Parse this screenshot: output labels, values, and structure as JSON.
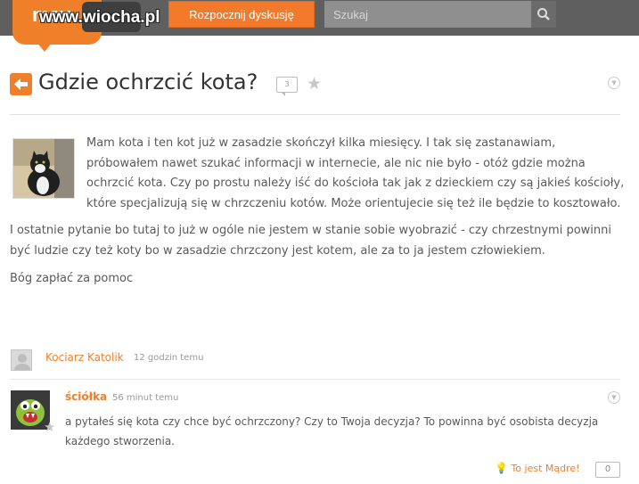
{
  "header": {
    "logo_text": "mov",
    "watermark": "www.wiocha.pl",
    "start_button_label": "Rozpocznij dyskusję",
    "search_placeholder": "Szukaj"
  },
  "question": {
    "title": "Gdzie ochrzcić kota?",
    "comment_count": "3",
    "paragraphs": [
      "Mam kota i ten kot już w zasadzie skończył kilka miesięcy. I tak się zastanawiam, próbowałem nawet szukać informacji w internecie, ale nic nie było - otóż gdzie można ochrzcić kota. Czy po prostu należy iść do kościoła tak jak z dzieckiem czy są jakieś kościoły, które specjalizują się w chrzczeniu kotów. Może orientujecie się też ile będzie to kosztowało.",
      "I ostatnie pytanie bo tutaj to już w ogóle nie jestem w stanie sobie wyobrazić - czy chrzestnymi powinni być ludzie czy też koty bo w zasadzie chrzczony jest kotem, ale za to ja jestem człowiekiem.",
      "Bóg zapłać za pomoc"
    ],
    "author": "Kociarz Katolik",
    "time": "12 godzin temu"
  },
  "comment": {
    "author": "ściółka",
    "time": "56 minut temu",
    "text": "a pytałeś się kota czy chce być ochrzczony? Czy to Twoja decyzja? To powinna być osobista decyzja każdego stworzenia.",
    "smart_label": "To jest Mądre!",
    "smart_count": "0"
  },
  "colors": {
    "accent": "#f07f2a",
    "topbar": "#5f5f5f"
  },
  "icons": [
    "search-icon",
    "back-arrow-icon",
    "comment-bubble-icon",
    "star-icon",
    "dropdown-icon",
    "lightbulb-icon"
  ]
}
